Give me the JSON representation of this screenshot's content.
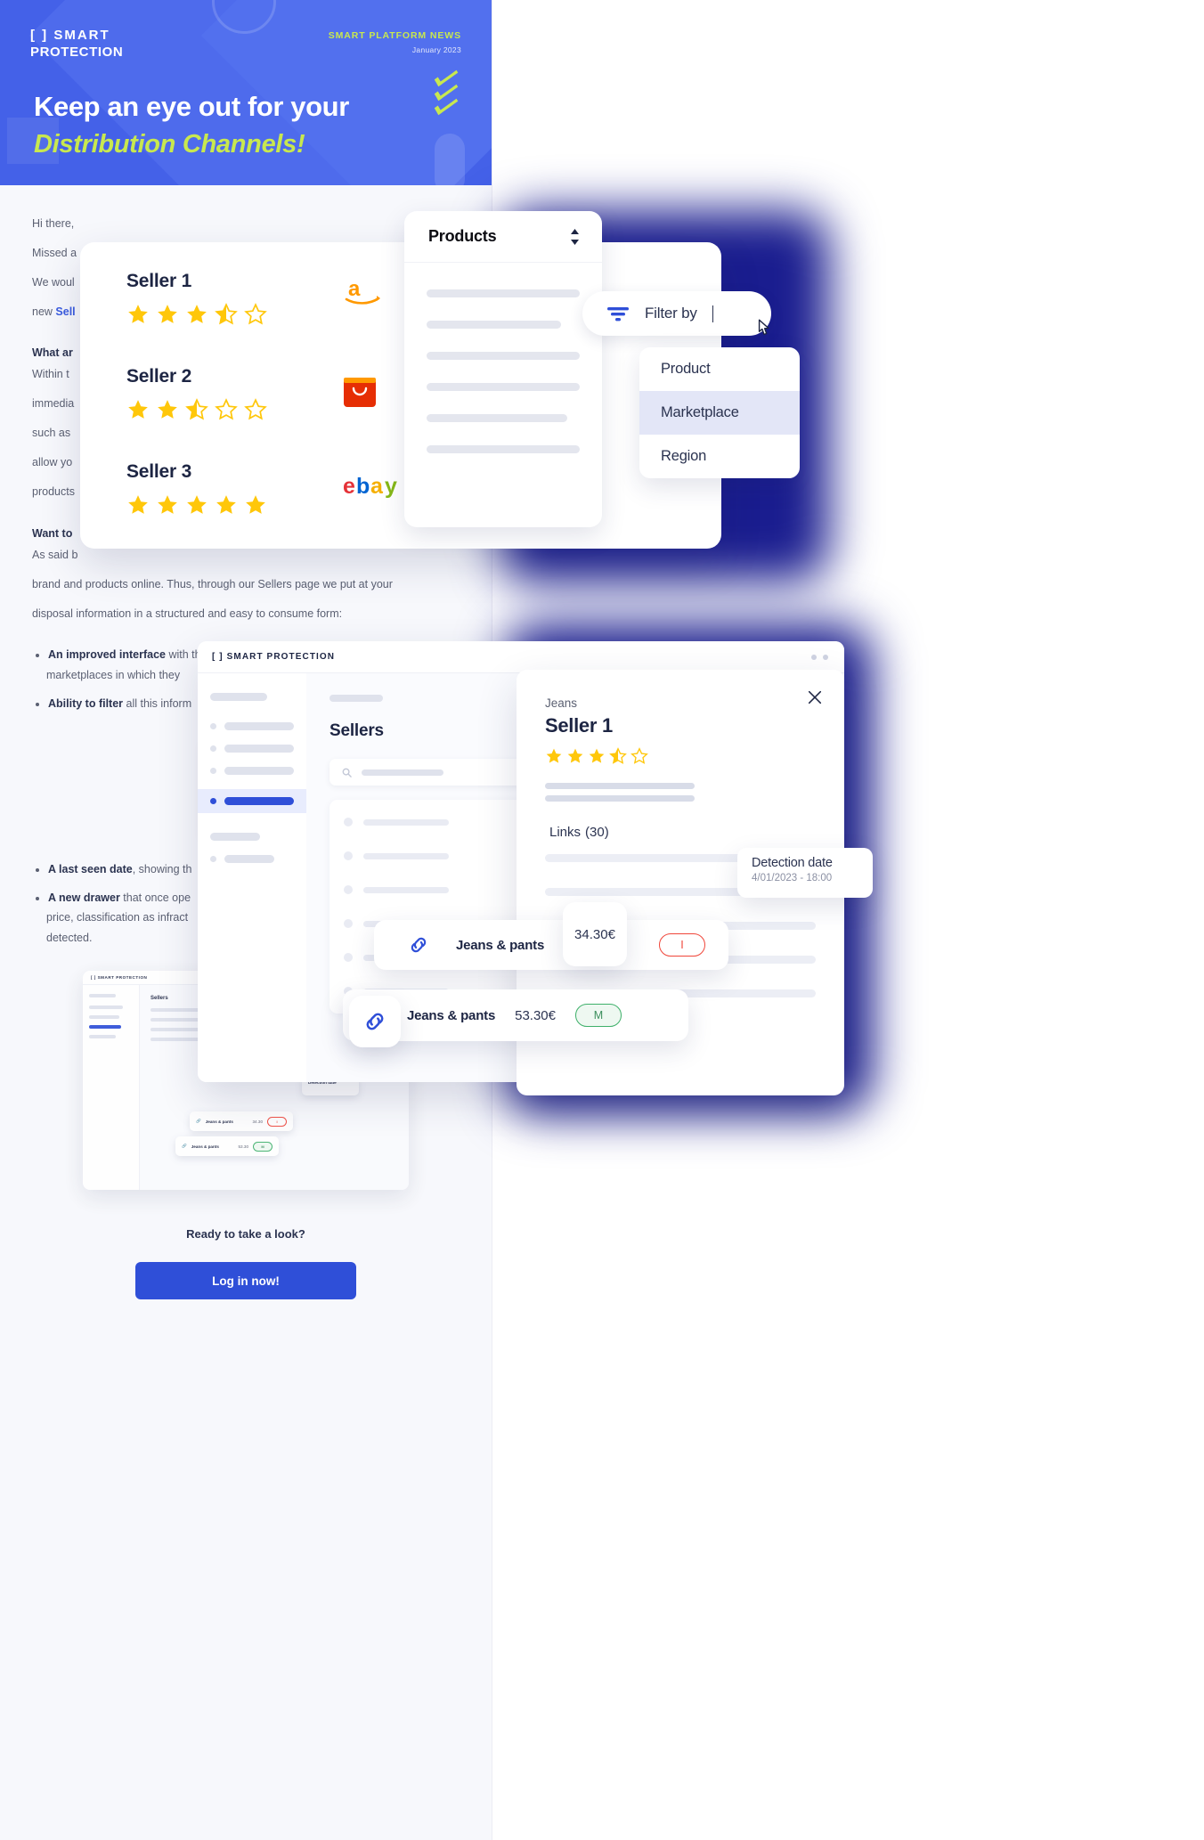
{
  "email": {
    "brand_line1": "[ ] SMART",
    "brand_line2": "PROTECTION",
    "kicker": "SMART PLATFORM NEWS",
    "date": "January 2023",
    "headline_1": "Keep an eye out for your",
    "headline_2": "Distribution Channels!",
    "greeting": "Hi there,",
    "para_missed": "Missed a",
    "para_would_1": "We woul",
    "para_would_2": "new ",
    "link_sellers": "Sell",
    "heading_what": "What ar",
    "body_1": "Within t",
    "body_2": "immedia",
    "body_3": "such as",
    "body_4": "allow yo",
    "body_5": "products",
    "heading_want": "Want to",
    "body_6": "As said b",
    "body_7": "brand and products online. Thus, through our Sellers page we put at your",
    "body_8": "disposal information in a structured and easy to consume form:",
    "bullets": [
      {
        "bold": "An improved interface",
        "rest": " with the names of the sellers, their rating and all the"
      },
      {
        "bold": "",
        "rest": "marketplaces in which they"
      },
      {
        "bold": "Ability to filter",
        "rest": " all this inform"
      },
      {
        "bold": "A last seen date",
        "rest": ", showing th"
      },
      {
        "bold": "A new drawer",
        "rest": " that once ope"
      },
      {
        "bold": "",
        "rest": "price, classification as infract"
      },
      {
        "bold": "",
        "rest": "detected."
      }
    ],
    "mini_sellers": [
      {
        "name": "Seller 1",
        "stars": "★★★☆☆"
      },
      {
        "name": "Seller 2",
        "stars": "★★☆☆☆"
      },
      {
        "name": "Seller 3",
        "stars": "★★★★★"
      }
    ],
    "mini_app": {
      "brand": "[ ] SMART PROTECTION",
      "title": "Sellers",
      "links_label": "Links  (30)",
      "tooltip_title": "Detection date",
      "row1_name": "Jeans & pants",
      "row1_price": "34.30",
      "row2_name": "Jeans & pants",
      "row2_price": "53.30"
    },
    "cta_question": "Ready to take a look?",
    "cta_button": "Log in now!"
  },
  "sellers_card": {
    "rows": [
      {
        "name": "Seller 1",
        "rating": 3.5,
        "marketplace": "amazon"
      },
      {
        "name": "Seller 2",
        "rating": 2.5,
        "marketplace": "aliexpress"
      },
      {
        "name": "Seller 3",
        "rating": 5,
        "marketplace": "ebay"
      }
    ]
  },
  "products_panel": {
    "title": "Products",
    "rows": 6
  },
  "filter": {
    "label": "Filter by",
    "options": [
      {
        "label": "Product",
        "selected": false
      },
      {
        "label": "Marketplace",
        "selected": true
      },
      {
        "label": "Region",
        "selected": false
      }
    ]
  },
  "dashboard": {
    "brand": "[ ]  SMART  PROTECTION",
    "page_title": "Sellers",
    "sidebar_items": 5,
    "list_rows": 6
  },
  "drawer": {
    "category": "Jeans",
    "seller_name": "Seller 1",
    "rating": 3.5,
    "links_label": "Links",
    "links_count": "(30)",
    "close_icon": "close-icon"
  },
  "tooltip": {
    "title": "Detection date",
    "value": "4/01/2023 - 18:00"
  },
  "product_rows": [
    {
      "name": "Jeans & pants",
      "price": "34.30€",
      "chip": "I",
      "chip_type": "red"
    },
    {
      "name": "Jeans & pants",
      "price": "53.30€",
      "chip": "M",
      "chip_type": "green"
    }
  ],
  "floating_price": "34.30€",
  "colors": {
    "brand_blue": "#2f4fd8",
    "hero_blue": "#4461e8",
    "lime": "#c8e84f",
    "navy": "#1d2543",
    "star_gold": "#ffc70a",
    "red": "#f0463a",
    "green": "#3eb06a"
  }
}
